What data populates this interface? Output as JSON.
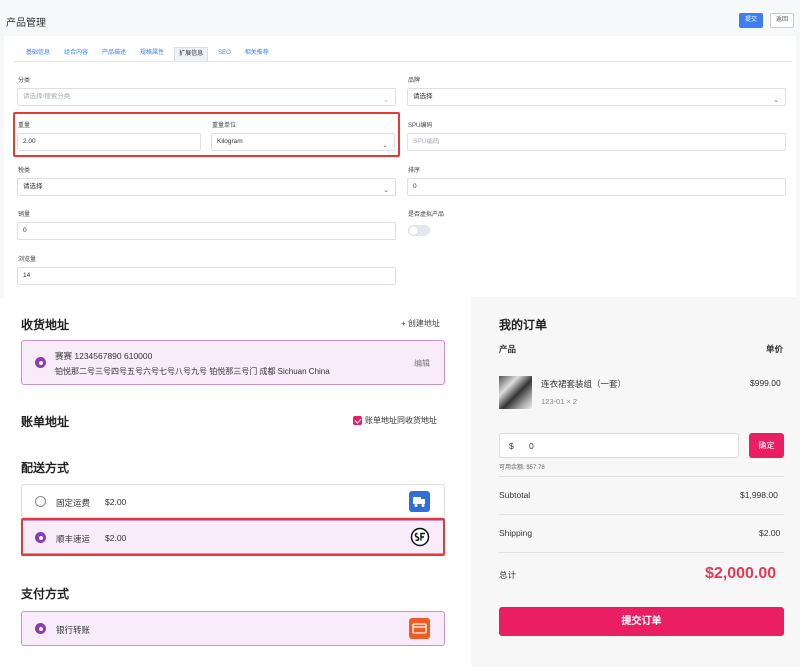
{
  "admin": {
    "title": "产品管理",
    "submit_label": "提交",
    "back_label": "返回",
    "tabs": [
      "基础信息",
      "组合内容",
      "产品描述",
      "规格属性",
      "扩展信息",
      "SEO",
      "相关推荐"
    ],
    "active_tab": "扩展信息",
    "fields": {
      "category_label": "分类",
      "category_placeholder": "请选择/搜索分类",
      "brand_label": "品牌",
      "brand_value": "请选择",
      "weight_label": "重量",
      "weight_value": "2.00",
      "weight_unit_label": "重量单位",
      "weight_unit_value": "Kilogram",
      "spu_label": "SPU编码",
      "spu_placeholder": "SPU编码",
      "tax_label": "税类",
      "tax_value": "请选择",
      "sort_label": "排序",
      "sort_value": "0",
      "sales_label": "销量",
      "sales_value": "0",
      "virtual_label": "是否虚拟产品",
      "views_label": "浏览量",
      "views_value": "14"
    }
  },
  "checkout": {
    "shipping_address_title": "收货地址",
    "new_address_link": "+ 创建地址",
    "address": {
      "line1": "赛赛 1234567890 610000",
      "line2": "铂悦那二号三号四号五号六号七号八号九号 铂悦那三号门 成都 Sichuan China",
      "edit_label": "编辑"
    },
    "billing_address_title": "账单地址",
    "same_as_shipping_label": "账单地址同收货地址",
    "shipping_method_title": "配送方式",
    "shipping_methods": [
      {
        "name": "固定运费",
        "price": "$2.00",
        "icon": "truck-icon",
        "selected": false
      },
      {
        "name": "顺丰速运",
        "price": "$2.00",
        "icon": "sf-express-icon",
        "selected": true
      }
    ],
    "payment_method_title": "支付方式",
    "payment_methods": [
      {
        "name": "银行转账",
        "icon": "bank-card-icon",
        "selected": true
      }
    ]
  },
  "order": {
    "title": "我的订单",
    "col_product": "产品",
    "col_price": "单价",
    "item": {
      "name": "连衣裙套装组（一套）",
      "meta": "123-01 × 2",
      "price": "$999.00"
    },
    "coupon_currency": "$",
    "coupon_value": "0",
    "coupon_btn": "确定",
    "balance_note": "可用余额: $57.78",
    "subtotal_label": "Subtotal",
    "subtotal_value": "$1,998.00",
    "shipping_label": "Shipping",
    "shipping_value": "$2.00",
    "total_label": "总计",
    "total_value": "$2,000.00",
    "place_order_label": "提交订单"
  },
  "colors": {
    "accent": "#e91e63",
    "admin_blue": "#3d7ff0",
    "purple": "#8e3bb0",
    "highlight_red": "#e53935"
  }
}
